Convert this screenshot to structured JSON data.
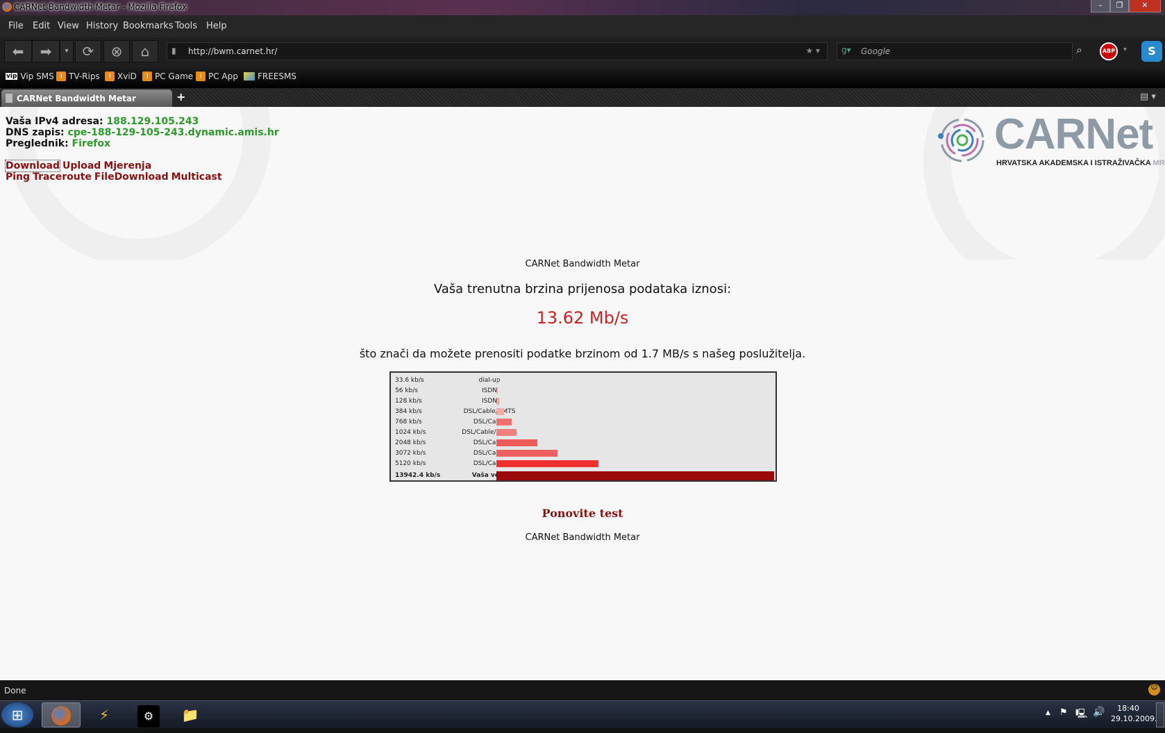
{
  "window": {
    "title": "CARNet Bandwidth Metar - Mozilla Firefox"
  },
  "menu": [
    "File",
    "Edit",
    "View",
    "History",
    "Bookmarks",
    "Tools",
    "Help"
  ],
  "nav": {
    "url": "http://bwm.carnet.hr/",
    "search_placeholder": "Google",
    "abp": "ABP"
  },
  "bookmarks": [
    "Vip SMS",
    "TV-Rips",
    "XviD",
    "PC Game",
    "PC App",
    "FREESMS"
  ],
  "tabs": [
    {
      "label": "CARNet Bandwidth Metar"
    }
  ],
  "page": {
    "ip_label": "Vaša IPv4 adresa:",
    "ip": "188.129.105.243",
    "dns_label": "DNS zapis:",
    "dns": "cpe-188-129-105-243.dynamic.amis.hr",
    "browser_label": "Preglednik:",
    "browser": "Firefox",
    "links_row1": [
      "Download",
      "Upload",
      "Mjerenja"
    ],
    "links_row2": [
      "Ping",
      "Traceroute",
      "FileDownload",
      "Multicast"
    ],
    "logo_text": "CARNet",
    "logo_sub": "HRVATSKA AKADEMSKA I ISTRAŽIVAČKA",
    "logo_sub2": "MREŽA",
    "title": "CARNet Bandwidth Metar",
    "heading": "Vaša trenutna brzina prijenosa podataka iznosi:",
    "speed": "13.62 Mb/s",
    "sentence": "što znači da možete prenositi podatke brzinom od 1.7 MB/s s našeg poslužitelja.",
    "retest": "Ponovite test",
    "footer": "CARNet Bandwidth Metar"
  },
  "chart_data": {
    "type": "bar",
    "orientation": "horizontal",
    "unit": "kb/s",
    "xlim": [
      0,
      13942.4
    ],
    "rows": [
      {
        "label": "33.6 kb/s",
        "category": "dial-up",
        "value": 33.6,
        "color": "#f4b0b0"
      },
      {
        "label": "56 kb/s",
        "category": "ISDN",
        "value": 56,
        "color": "#f4b0b0"
      },
      {
        "label": "128 kb/s",
        "category": "ISDN",
        "value": 128,
        "color": "#f4a0a0"
      },
      {
        "label": "384 kb/s",
        "category": "DSL/Cable/UMTS",
        "value": 384,
        "color": "#f8a8a8"
      },
      {
        "label": "768 kb/s",
        "category": "DSL/Cable",
        "value": 768,
        "color": "#f07070"
      },
      {
        "label": "1024 kb/s",
        "category": "DSL/Cable/HSDPA",
        "value": 1024,
        "color": "#f08080"
      },
      {
        "label": "2048 kb/s",
        "category": "DSL/Cable",
        "value": 2048,
        "color": "#ec5a5a"
      },
      {
        "label": "3072 kb/s",
        "category": "DSL/Cable",
        "value": 3072,
        "color": "#ee6060"
      },
      {
        "label": "5120 kb/s",
        "category": "DSL/Cable",
        "value": 5120,
        "color": "#f03030"
      },
      {
        "label": "13942.4 kb/s",
        "category": "Vaša veza",
        "value": 13942.4,
        "color": "#9a0a0a",
        "bold": true
      }
    ]
  },
  "status": {
    "text": "Done"
  },
  "taskbar": {
    "time": "18:40",
    "date": "29.10.2009."
  }
}
